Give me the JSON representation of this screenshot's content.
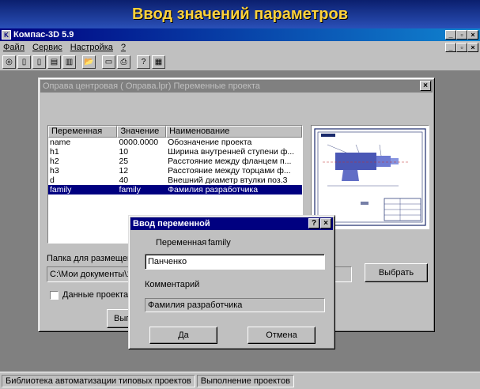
{
  "slide": {
    "title": "Ввод значений параметров"
  },
  "app": {
    "title": "Компас-3D 5.9",
    "window_buttons": [
      "_",
      "▫",
      "×"
    ],
    "menu": [
      "Файл",
      "Сервис",
      "Настройка",
      "?"
    ],
    "menu_controls": [
      "_",
      "▫",
      "×"
    ]
  },
  "project_dialog": {
    "title": "Оправа центровая ( Оправа.lpr) Переменные проекта",
    "close": "×",
    "columns": [
      "Переменная",
      "Значение",
      "Наименование"
    ],
    "rows": [
      [
        "name",
        "0000.0000",
        "Обозначение проекта"
      ],
      [
        "h1",
        "10",
        "Ширина внутренней ступени ф..."
      ],
      [
        "h2",
        "25",
        "Расстояние между фланцем п..."
      ],
      [
        "h3",
        "12",
        "Расстояние между торцами ф..."
      ],
      [
        "d",
        "40",
        "Внешний диаметр втулки поз.3"
      ],
      [
        "family",
        "family",
        "Фамилия разработчика"
      ]
    ],
    "selected_row": 5,
    "folder_label": "Папка для размещен",
    "folder_path": "C:\\Мои документы\\1",
    "choose_button": "Выбрать",
    "checkbox_label": "Данные проекта",
    "execute_button": "Вып"
  },
  "input_dialog": {
    "title": "Ввод переменной",
    "help": "?",
    "close": "×",
    "variable_label": "Переменная",
    "variable_name": "family",
    "value": "Панченко",
    "comment_label": "Комментарий",
    "comment": "Фамилия разработчика",
    "ok_button": "Да",
    "cancel_button": "Отмена"
  },
  "statusbar": {
    "left": "Библиотека автоматизации типовых проектов",
    "right": "Выполнение проектов"
  }
}
